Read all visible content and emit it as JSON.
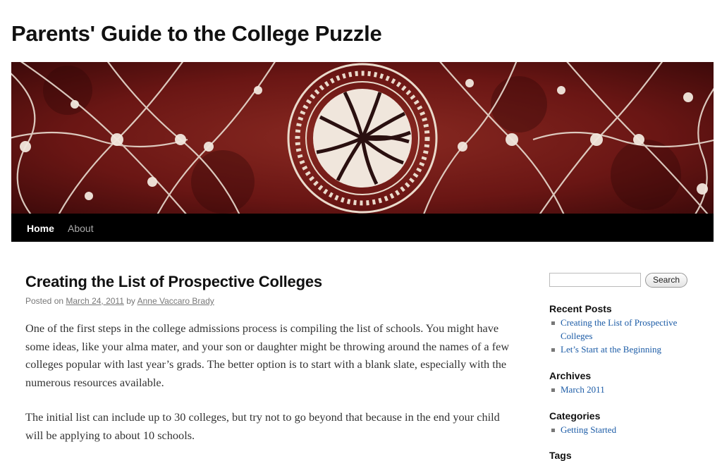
{
  "site": {
    "title": "Parents' Guide to the College Puzzle"
  },
  "nav": {
    "items": [
      {
        "label": "Home"
      },
      {
        "label": "About"
      }
    ]
  },
  "post": {
    "title": "Creating the List of Prospective Colleges",
    "meta_prefix": "Posted on",
    "date": "March 24, 2011",
    "meta_by": "by",
    "author": "Anne Vaccaro Brady",
    "paragraphs": [
      "One of the first steps in the college admissions process is compiling the list of schools. You might have some ideas, like your alma mater, and your son or daughter might be throwing around the names of a few colleges popular with last year’s grads. The better option is to start with a blank slate, especially with the numerous resources available.",
      "The initial list can include up to 30 colleges, but try not to go beyond that because in the end your child will be applying to about 10 schools."
    ]
  },
  "sidebar": {
    "search": {
      "placeholder": "",
      "button_label": "Search"
    },
    "recent_posts": {
      "title": "Recent Posts",
      "items": [
        "Creating the List of Prospective Colleges",
        "Let’s Start at the Beginning"
      ]
    },
    "archives": {
      "title": "Archives",
      "items": [
        "March 2011"
      ]
    },
    "categories": {
      "title": "Categories",
      "items": [
        "Getting Started"
      ]
    },
    "tags": {
      "title": "Tags"
    }
  },
  "colors": {
    "banner": "#6e1414",
    "nav_bg": "#000000",
    "link": "#1b5ba6"
  },
  "icons": {
    "bullet": "square-bullet-icon"
  }
}
